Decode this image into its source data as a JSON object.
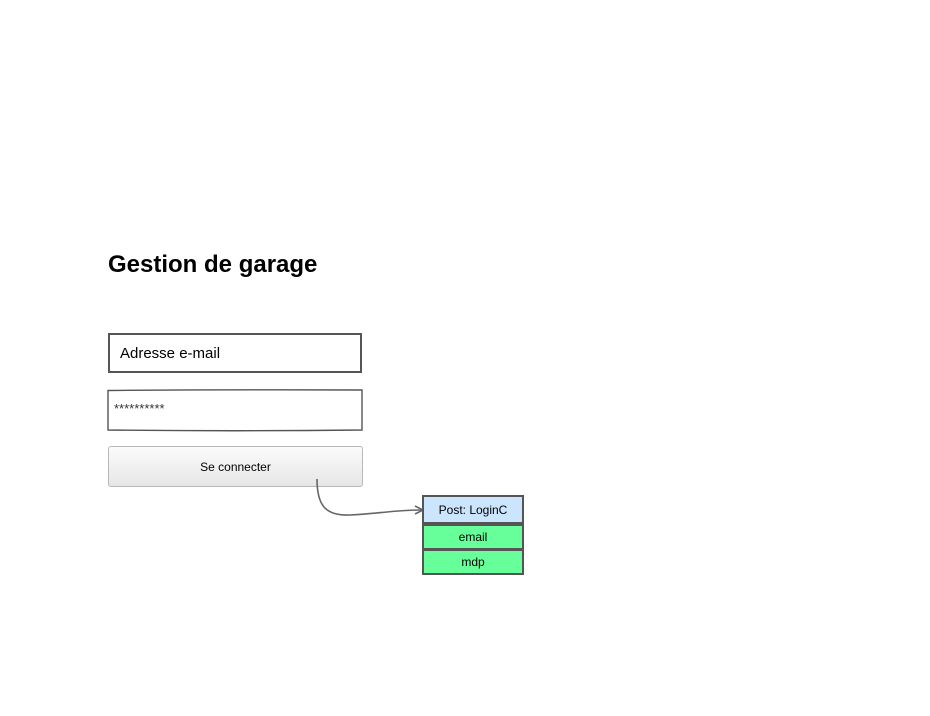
{
  "page": {
    "title": "Gestion de garage"
  },
  "form": {
    "email_placeholder": "Adresse e-mail",
    "password_mask": "**********",
    "submit_label": "Se connecter"
  },
  "request": {
    "method_label": "Post: LoginC",
    "fields": [
      "email",
      "mdp"
    ]
  },
  "colors": {
    "request_header": "#cce5ff",
    "request_field": "#66ff99",
    "border": "#555555"
  }
}
